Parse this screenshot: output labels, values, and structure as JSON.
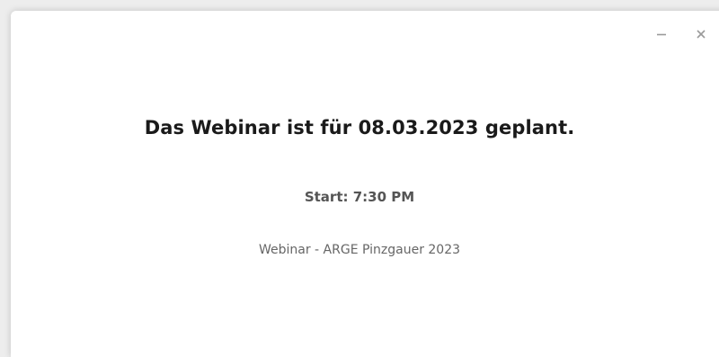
{
  "window": {
    "minimize_icon": "minimize-icon",
    "close_icon": "close-icon"
  },
  "main": {
    "title": "Das Webinar ist für 08.03.2023 geplant.",
    "start": "Start: 7:30 PM",
    "webinar_name": "Webinar - ARGE Pinzgauer 2023"
  },
  "colors": {
    "title": "#1a1a1a",
    "start": "#555555",
    "webinar_name": "#666666",
    "window_controls": "#9a9a9a"
  }
}
